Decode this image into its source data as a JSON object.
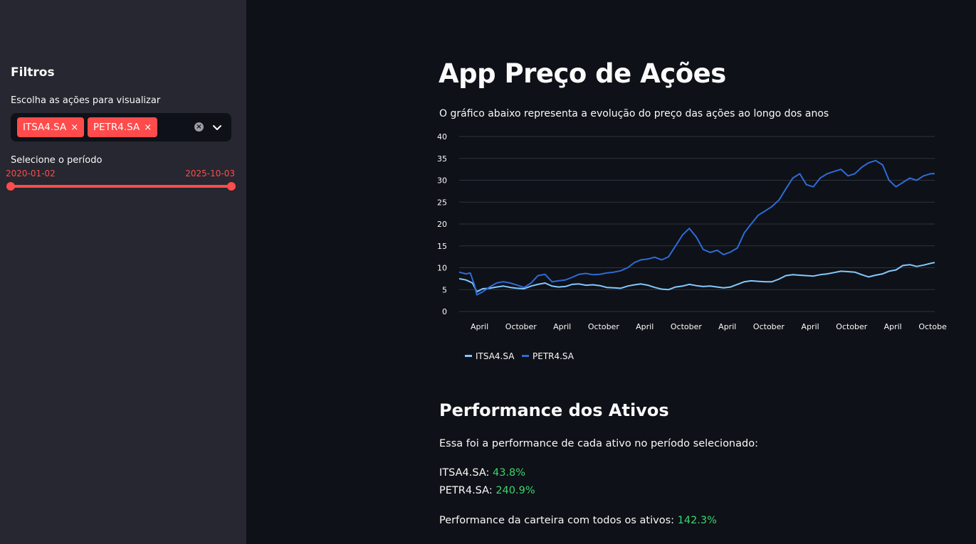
{
  "sidebar": {
    "title": "Filtros",
    "stocks_label": "Escolha as ações para visualizar",
    "selected_stocks": [
      "ITSA4.SA",
      "PETR4.SA"
    ],
    "chip_remove_glyph": "×",
    "clear_glyph": "×",
    "period_label": "Selecione o período",
    "period_start": "2020-01-02",
    "period_end": "2025-10-03"
  },
  "main": {
    "title": "App Preço de Ações",
    "caption": "O gráfico abaixo representa a evolução do preço das ações ao longo dos anos",
    "performance_title": "Performance dos Ativos",
    "performance_intro": "Essa foi a performance de cada ativo no período selecionado:",
    "assets": [
      {
        "name": "ITSA4.SA",
        "value": "43.8%"
      },
      {
        "name": "PETR4.SA",
        "value": "240.9%"
      }
    ],
    "portfolio_label": "Performance da carteira com todos os ativos:",
    "portfolio_value": "142.3%"
  },
  "colors": {
    "accent": "#ff4b4b",
    "positive": "#3dd56d",
    "itsa": "#83c9ff",
    "petr": "#2e6bd8"
  },
  "chart_data": {
    "type": "line",
    "title": "",
    "xlabel": "",
    "ylabel": "",
    "ylim": [
      0,
      40
    ],
    "yticks": [
      0,
      5,
      10,
      15,
      20,
      25,
      30,
      35,
      40
    ],
    "xticks": [
      {
        "label": "April",
        "date": "2020-04-01"
      },
      {
        "label": "October",
        "date": "2020-10-01"
      },
      {
        "label": "April",
        "date": "2021-04-01"
      },
      {
        "label": "October",
        "date": "2021-10-01"
      },
      {
        "label": "April",
        "date": "2022-04-01"
      },
      {
        "label": "October",
        "date": "2022-10-01"
      },
      {
        "label": "April",
        "date": "2023-04-01"
      },
      {
        "label": "October",
        "date": "2023-10-01"
      },
      {
        "label": "April",
        "date": "2024-04-01"
      },
      {
        "label": "October",
        "date": "2024-10-01"
      },
      {
        "label": "April",
        "date": "2025-04-01"
      },
      {
        "label": "October",
        "date": "2025-10-01"
      }
    ],
    "x_range": [
      "2020-01-02",
      "2025-10-03"
    ],
    "grid": true,
    "legend_position": "bottom-left",
    "series": [
      {
        "name": "ITSA4.SA",
        "points": [
          [
            "2020-01-02",
            7.5
          ],
          [
            "2020-02-01",
            7.2
          ],
          [
            "2020-03-01",
            6.5
          ],
          [
            "2020-03-20",
            4.5
          ],
          [
            "2020-04-15",
            5.2
          ],
          [
            "2020-05-15",
            5.3
          ],
          [
            "2020-06-15",
            5.6
          ],
          [
            "2020-07-15",
            5.8
          ],
          [
            "2020-08-15",
            5.5
          ],
          [
            "2020-09-15",
            5.3
          ],
          [
            "2020-10-15",
            5.2
          ],
          [
            "2020-11-15",
            5.8
          ],
          [
            "2020-12-15",
            6.2
          ],
          [
            "2021-01-15",
            6.5
          ],
          [
            "2021-02-15",
            5.8
          ],
          [
            "2021-03-15",
            5.6
          ],
          [
            "2021-04-15",
            5.7
          ],
          [
            "2021-05-15",
            6.2
          ],
          [
            "2021-06-15",
            6.3
          ],
          [
            "2021-07-15",
            6.0
          ],
          [
            "2021-08-15",
            6.1
          ],
          [
            "2021-09-15",
            5.9
          ],
          [
            "2021-10-15",
            5.5
          ],
          [
            "2021-11-15",
            5.4
          ],
          [
            "2021-12-15",
            5.3
          ],
          [
            "2022-01-15",
            5.8
          ],
          [
            "2022-02-15",
            6.1
          ],
          [
            "2022-03-15",
            6.3
          ],
          [
            "2022-04-15",
            6.0
          ],
          [
            "2022-05-15",
            5.5
          ],
          [
            "2022-06-15",
            5.1
          ],
          [
            "2022-07-15",
            5.0
          ],
          [
            "2022-08-15",
            5.6
          ],
          [
            "2022-09-15",
            5.8
          ],
          [
            "2022-10-15",
            6.2
          ],
          [
            "2022-11-15",
            5.9
          ],
          [
            "2022-12-15",
            5.7
          ],
          [
            "2023-01-15",
            5.8
          ],
          [
            "2023-02-15",
            5.6
          ],
          [
            "2023-03-15",
            5.4
          ],
          [
            "2023-04-15",
            5.6
          ],
          [
            "2023-05-15",
            6.2
          ],
          [
            "2023-06-15",
            6.8
          ],
          [
            "2023-07-15",
            7.0
          ],
          [
            "2023-08-15",
            6.9
          ],
          [
            "2023-09-15",
            6.8
          ],
          [
            "2023-10-15",
            6.8
          ],
          [
            "2023-11-15",
            7.4
          ],
          [
            "2023-12-15",
            8.2
          ],
          [
            "2024-01-15",
            8.4
          ],
          [
            "2024-02-15",
            8.3
          ],
          [
            "2024-03-15",
            8.2
          ],
          [
            "2024-04-15",
            8.1
          ],
          [
            "2024-05-15",
            8.4
          ],
          [
            "2024-06-15",
            8.6
          ],
          [
            "2024-07-15",
            8.9
          ],
          [
            "2024-08-15",
            9.2
          ],
          [
            "2024-09-15",
            9.1
          ],
          [
            "2024-10-15",
            9.0
          ],
          [
            "2024-11-15",
            8.4
          ],
          [
            "2024-12-15",
            7.9
          ],
          [
            "2025-01-15",
            8.3
          ],
          [
            "2025-02-15",
            8.6
          ],
          [
            "2025-03-15",
            9.2
          ],
          [
            "2025-04-15",
            9.5
          ],
          [
            "2025-05-15",
            10.5
          ],
          [
            "2025-06-15",
            10.7
          ],
          [
            "2025-07-15",
            10.3
          ],
          [
            "2025-08-15",
            10.6
          ],
          [
            "2025-09-15",
            11.0
          ],
          [
            "2025-10-03",
            11.2
          ]
        ]
      },
      {
        "name": "PETR4.SA",
        "points": [
          [
            "2020-01-02",
            9.0
          ],
          [
            "2020-02-01",
            8.6
          ],
          [
            "2020-02-20",
            8.8
          ],
          [
            "2020-03-10",
            6.0
          ],
          [
            "2020-03-20",
            3.8
          ],
          [
            "2020-04-15",
            4.5
          ],
          [
            "2020-05-15",
            5.6
          ],
          [
            "2020-06-15",
            6.5
          ],
          [
            "2020-07-15",
            6.8
          ],
          [
            "2020-08-15",
            6.5
          ],
          [
            "2020-09-15",
            6.0
          ],
          [
            "2020-10-15",
            5.5
          ],
          [
            "2020-11-15",
            6.5
          ],
          [
            "2020-12-15",
            8.2
          ],
          [
            "2021-01-15",
            8.5
          ],
          [
            "2021-02-15",
            6.8
          ],
          [
            "2021-03-15",
            7.0
          ],
          [
            "2021-04-15",
            7.2
          ],
          [
            "2021-05-15",
            7.8
          ],
          [
            "2021-06-15",
            8.5
          ],
          [
            "2021-07-15",
            8.7
          ],
          [
            "2021-08-15",
            8.4
          ],
          [
            "2021-09-15",
            8.5
          ],
          [
            "2021-10-15",
            8.8
          ],
          [
            "2021-11-15",
            9.0
          ],
          [
            "2021-12-15",
            9.3
          ],
          [
            "2022-01-15",
            10.0
          ],
          [
            "2022-02-15",
            11.2
          ],
          [
            "2022-03-15",
            11.8
          ],
          [
            "2022-04-15",
            12.0
          ],
          [
            "2022-05-15",
            12.4
          ],
          [
            "2022-06-15",
            11.8
          ],
          [
            "2022-07-15",
            12.5
          ],
          [
            "2022-08-15",
            15.0
          ],
          [
            "2022-09-15",
            17.5
          ],
          [
            "2022-10-15",
            19.0
          ],
          [
            "2022-11-15",
            17.0
          ],
          [
            "2022-12-15",
            14.2
          ],
          [
            "2023-01-15",
            13.5
          ],
          [
            "2023-02-15",
            14.0
          ],
          [
            "2023-03-15",
            13.0
          ],
          [
            "2023-04-15",
            13.6
          ],
          [
            "2023-05-15",
            14.5
          ],
          [
            "2023-06-15",
            18.0
          ],
          [
            "2023-07-15",
            20.0
          ],
          [
            "2023-08-15",
            22.0
          ],
          [
            "2023-09-15",
            23.0
          ],
          [
            "2023-10-15",
            24.0
          ],
          [
            "2023-11-15",
            25.5
          ],
          [
            "2023-12-15",
            28.0
          ],
          [
            "2024-01-15",
            30.5
          ],
          [
            "2024-02-15",
            31.5
          ],
          [
            "2024-03-15",
            29.0
          ],
          [
            "2024-04-15",
            28.5
          ],
          [
            "2024-05-15",
            30.5
          ],
          [
            "2024-06-15",
            31.5
          ],
          [
            "2024-07-15",
            32.0
          ],
          [
            "2024-08-15",
            32.5
          ],
          [
            "2024-09-15",
            31.0
          ],
          [
            "2024-10-15",
            31.5
          ],
          [
            "2024-11-15",
            33.0
          ],
          [
            "2024-12-15",
            34.0
          ],
          [
            "2025-01-15",
            34.5
          ],
          [
            "2025-02-15",
            33.5
          ],
          [
            "2025-03-15",
            30.0
          ],
          [
            "2025-04-15",
            28.5
          ],
          [
            "2025-05-15",
            29.5
          ],
          [
            "2025-06-15",
            30.5
          ],
          [
            "2025-07-15",
            30.0
          ],
          [
            "2025-08-15",
            31.0
          ],
          [
            "2025-09-15",
            31.5
          ],
          [
            "2025-10-03",
            31.5
          ]
        ]
      }
    ]
  }
}
